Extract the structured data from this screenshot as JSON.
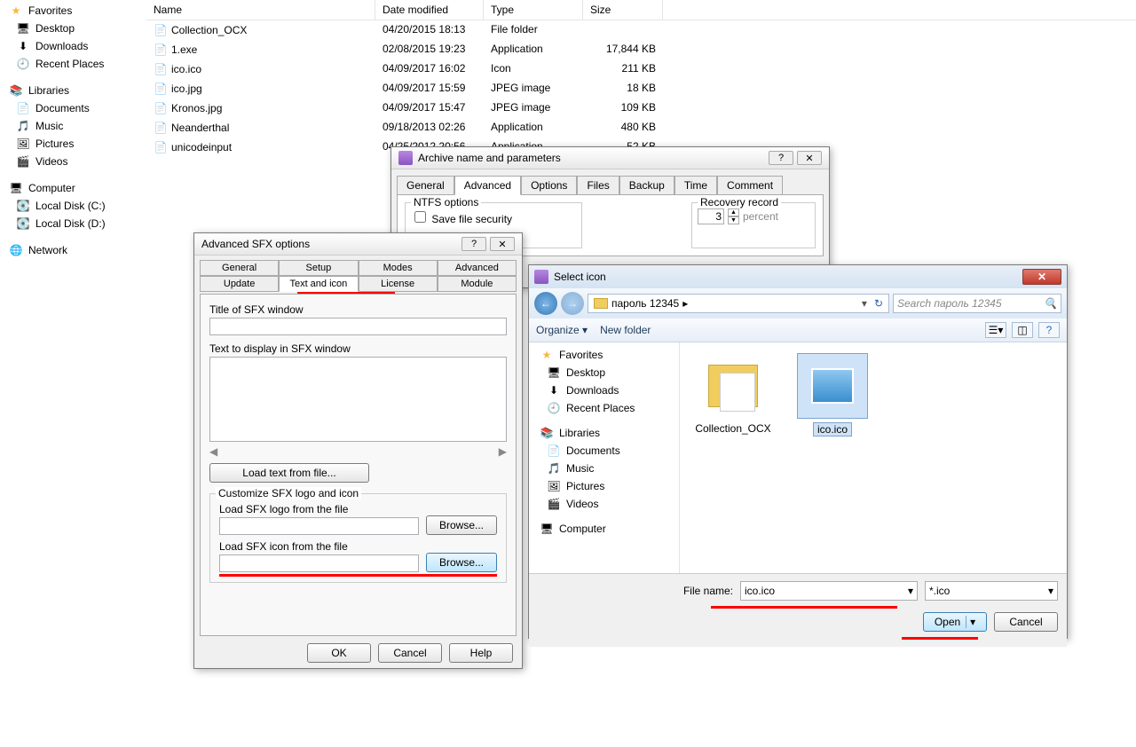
{
  "explorer": {
    "nav": {
      "favorites": "Favorites",
      "favorites_items": [
        "Desktop",
        "Downloads",
        "Recent Places"
      ],
      "libraries": "Libraries",
      "libraries_items": [
        "Documents",
        "Music",
        "Pictures",
        "Videos"
      ],
      "computer": "Computer",
      "computer_items": [
        "Local Disk (C:)",
        "Local Disk (D:)"
      ],
      "network": "Network"
    },
    "headers": {
      "name": "Name",
      "date": "Date modified",
      "type": "Type",
      "size": "Size"
    },
    "files": [
      {
        "name": "Collection_OCX",
        "date": "04/20/2015 18:13",
        "type": "File folder",
        "size": ""
      },
      {
        "name": "1.exe",
        "date": "02/08/2015 19:23",
        "type": "Application",
        "size": "17,844 KB"
      },
      {
        "name": "ico.ico",
        "date": "04/09/2017 16:02",
        "type": "Icon",
        "size": "211 KB"
      },
      {
        "name": "ico.jpg",
        "date": "04/09/2017 15:59",
        "type": "JPEG image",
        "size": "18 KB"
      },
      {
        "name": "Kronos.jpg",
        "date": "04/09/2017 15:47",
        "type": "JPEG image",
        "size": "109 KB"
      },
      {
        "name": "Neanderthal",
        "date": "09/18/2013 02:26",
        "type": "Application",
        "size": "480 KB"
      },
      {
        "name": "unicodeinput",
        "date": "04/25/2012 20:56",
        "type": "Application",
        "size": "52 KB"
      }
    ]
  },
  "archive": {
    "title": "Archive name and parameters",
    "tabs": [
      "General",
      "Advanced",
      "Options",
      "Files",
      "Backup",
      "Time",
      "Comment"
    ],
    "active_tab": "Advanced",
    "ntfs_label": "NTFS options",
    "ntfs_check": "Save file security",
    "recovery_label": "Recovery record",
    "recovery_value": "3",
    "recovery_unit": "percent"
  },
  "sfx": {
    "title": "Advanced SFX options",
    "tabs_row1": [
      "General",
      "Setup",
      "Modes",
      "Advanced"
    ],
    "tabs_row2": [
      "Update",
      "Text and icon",
      "License",
      "Module"
    ],
    "active_tab": "Text and icon",
    "title_label": "Title of SFX window",
    "text_label": "Text to display in SFX window",
    "load_text_btn": "Load text from file...",
    "customize_label": "Customize SFX logo and icon",
    "logo_label": "Load SFX logo from the file",
    "icon_label": "Load SFX icon from the file",
    "browse_btn": "Browse...",
    "ok": "OK",
    "cancel": "Cancel",
    "help": "Help"
  },
  "sel": {
    "title": "Select icon",
    "path_folder": "пароль 12345",
    "path_arrow": "▸",
    "search_placeholder": "Search пароль 12345",
    "organize": "Organize ▾",
    "newfolder": "New folder",
    "nav": {
      "favorites": "Favorites",
      "favorites_items": [
        "Desktop",
        "Downloads",
        "Recent Places"
      ],
      "libraries": "Libraries",
      "libraries_items": [
        "Documents",
        "Music",
        "Pictures",
        "Videos"
      ],
      "computer": "Computer"
    },
    "items": [
      {
        "name": "Collection_OCX",
        "selected": false
      },
      {
        "name": "ico.ico",
        "selected": true
      }
    ],
    "filename_label": "File name:",
    "filename_value": "ico.ico",
    "filter": "*.ico",
    "open": "Open",
    "cancel": "Cancel"
  }
}
